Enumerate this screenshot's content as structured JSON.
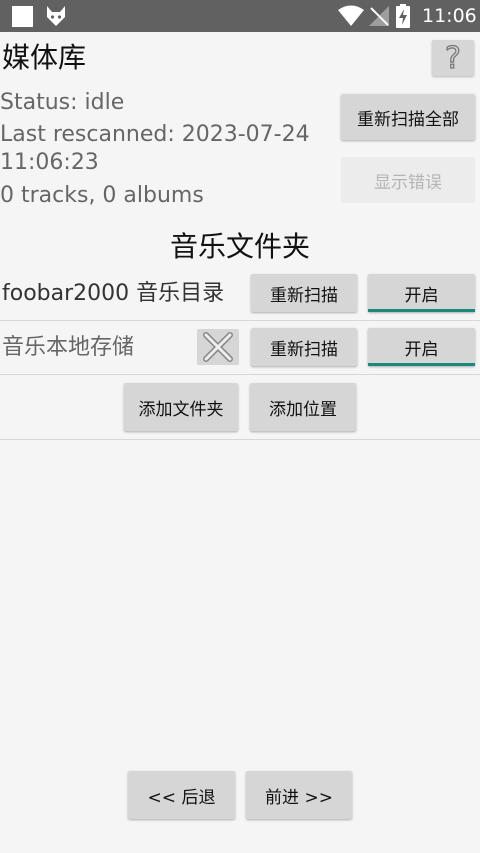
{
  "status_bar": {
    "time": "11:06"
  },
  "header": {
    "title": "媒体库",
    "help_label": "?"
  },
  "status": {
    "status_line": "Status: idle",
    "rescanned_line1": "Last rescanned: 2023-07-24",
    "rescanned_line2": "11:06:23",
    "summary": "0 tracks, 0 albums"
  },
  "actions": {
    "rescan_all": "重新扫描全部",
    "show_errors": "显示错误"
  },
  "folders": {
    "section_title": "音乐文件夹",
    "items": [
      {
        "name": "foobar2000 音乐目录",
        "rescan": "重新扫描",
        "toggle": "开启"
      },
      {
        "name": "音乐本地存储",
        "rescan": "重新扫描",
        "toggle": "开启"
      }
    ],
    "add_folder": "添加文件夹",
    "add_location": "添加位置"
  },
  "nav": {
    "back": "<< 后退",
    "next": "前进 >>"
  },
  "colors": {
    "accent": "#1a8a7a",
    "status_bar": "#616161",
    "button": "#d6d6d6"
  }
}
